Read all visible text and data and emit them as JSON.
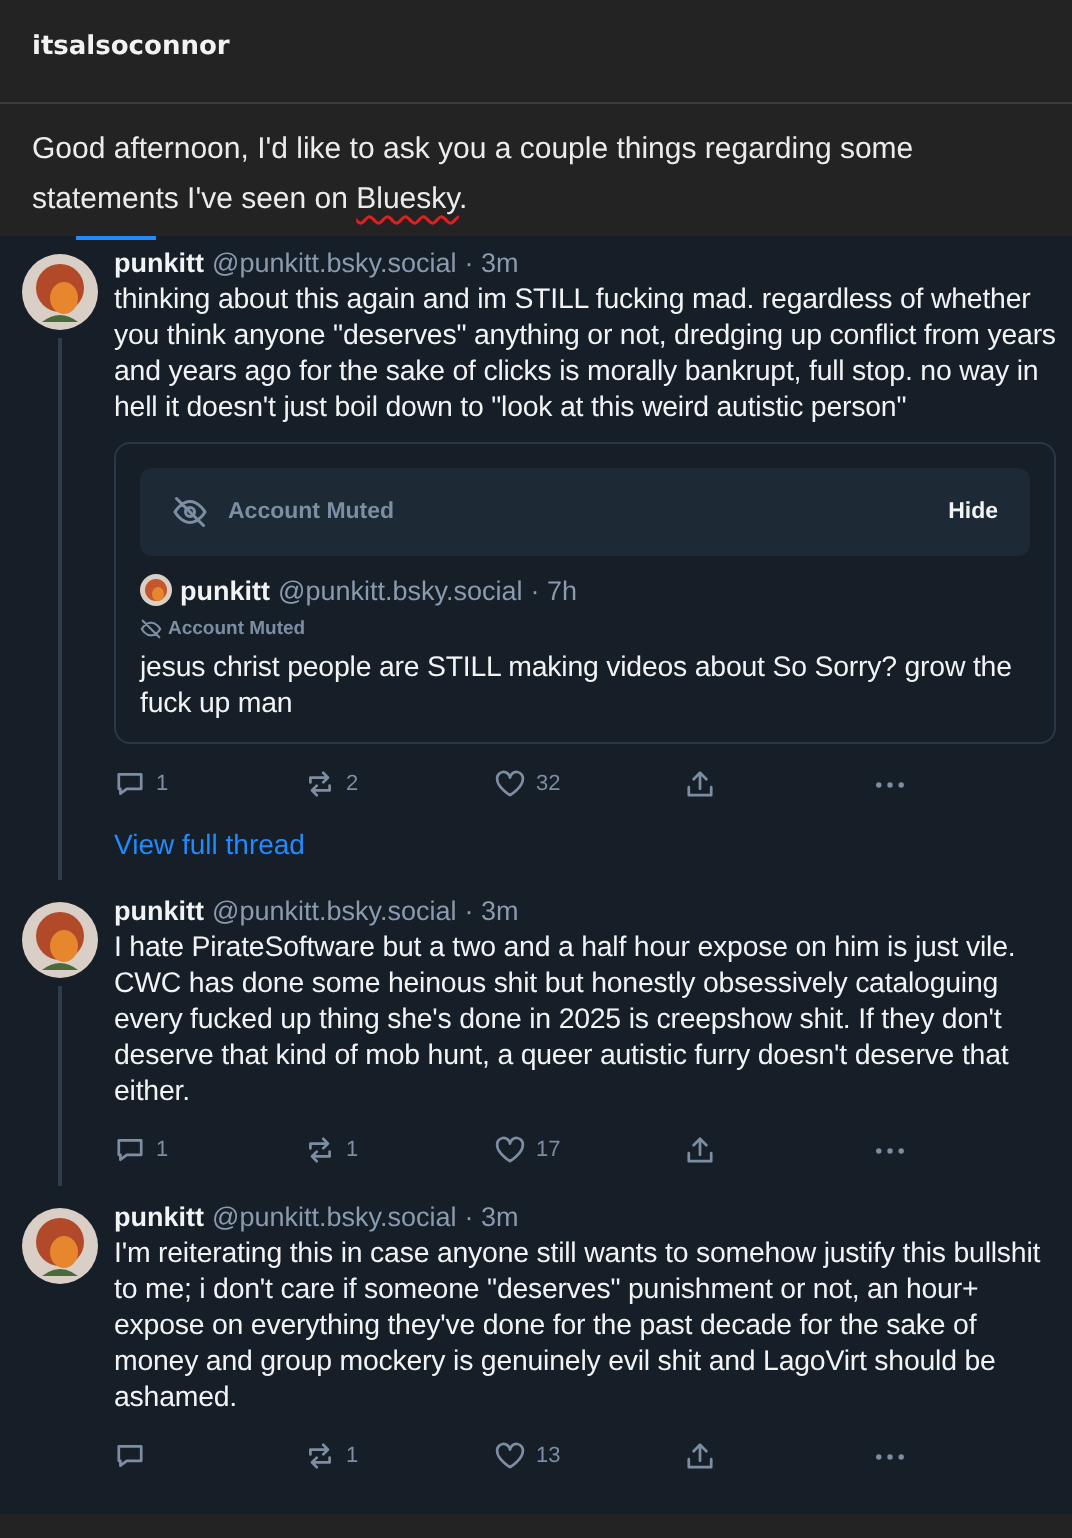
{
  "message": {
    "author": "itsalsoconnor",
    "text_before": "Good afternoon, I'd like to ask you a couple things regarding some statements I've seen on ",
    "flagged_word": "Bluesky",
    "flagged_misspelled": true,
    "text_after": "."
  },
  "posts": [
    {
      "name": "punkitt",
      "handle": "@punkitt.bsky.social",
      "time": "· 3m",
      "thread_line": true,
      "text": "thinking about this again and im STILL fucking mad. regardless of whether you think anyone \"deserves\" anything or not, dredging up conflict from years and years ago for the sake of clicks is morally bankrupt, full stop. no way in hell it doesn't just boil down to \"look at this weird autistic person\"",
      "quote": {
        "banner": "Account Muted",
        "hide": "Hide",
        "name": "punkitt",
        "handle": "@punkitt.bsky.social",
        "time": "· 7h",
        "muted_tag": "Account Muted",
        "text": "jesus christ people are STILL making videos about So Sorry? grow the fuck up man"
      },
      "replies": "1",
      "reposts": "2",
      "likes": "32",
      "view_thread": "View full thread"
    },
    {
      "name": "punkitt",
      "handle": "@punkitt.bsky.social",
      "time": "· 3m",
      "thread_line": true,
      "text": "I hate PirateSoftware but a two and a half hour expose on him is just vile. CWC has done some heinous shit but honestly obsessively cataloguing every fucked up thing she's done in 2025 is creepshow shit. If they don't deserve that kind of mob hunt, a queer autistic furry doesn't deserve that either.",
      "replies": "1",
      "reposts": "1",
      "likes": "17"
    },
    {
      "name": "punkitt",
      "handle": "@punkitt.bsky.social",
      "time": "· 3m",
      "thread_line": false,
      "text": "I'm reiterating this in case anyone still wants to somehow justify this bullshit to me; i don't care if someone \"deserves\" punishment or not, an hour+ expose on everything they've done for the past decade for the sake of money and group mockery is genuinely evil shit and LagoVirt should be ashamed.",
      "reposts": "1",
      "likes": "13"
    }
  ]
}
